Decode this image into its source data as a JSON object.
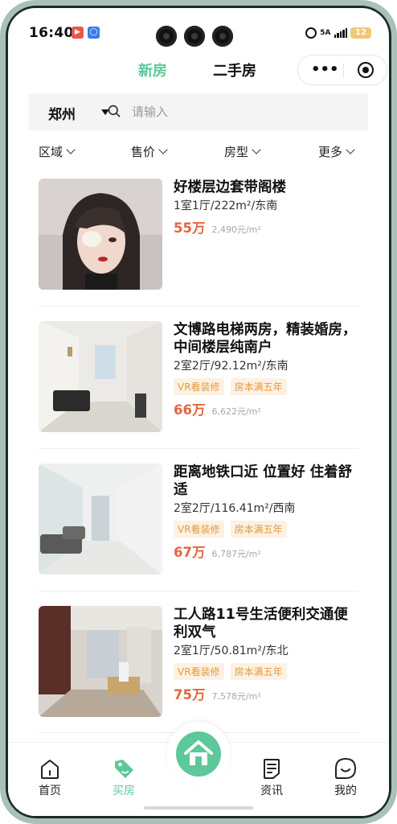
{
  "status_bar": {
    "time": "16:40",
    "network": "5A",
    "battery": "12",
    "accent_battery": "#f0c875"
  },
  "top_nav": {
    "tabs": [
      {
        "label": "新房",
        "active": true
      },
      {
        "label": "二手房",
        "active": false
      }
    ],
    "more_icon": "more-dots-icon",
    "target_icon": "target-icon"
  },
  "search": {
    "city": "郑州",
    "placeholder": "请输入"
  },
  "filters": [
    {
      "label": "区域"
    },
    {
      "label": "售价"
    },
    {
      "label": "房型"
    },
    {
      "label": "更多"
    }
  ],
  "listings": [
    {
      "title": "好楼层边套带阁楼",
      "spec": "1室1厅/222m²/东南",
      "tags": [],
      "price": "55万",
      "unit_price": "2,490元/m²"
    },
    {
      "title": "文博路电梯两房，精装婚房，中间楼层纯南户",
      "spec": "2室2厅/92.12m²/东南",
      "tags": [
        "VR看装修",
        "房本满五年"
      ],
      "price": "66万",
      "unit_price": "6,622元/m²"
    },
    {
      "title": "距离地铁口近 位置好 住着舒适",
      "spec": "2室2厅/116.41m²/西南",
      "tags": [
        "VR看装修",
        "房本满五年"
      ],
      "price": "67万",
      "unit_price": "6,787元/m²"
    },
    {
      "title": "工人路11号生活便利交通便利双气",
      "spec": "2室1厅/50.81m²/东北",
      "tags": [
        "VR看装修",
        "房本满五年"
      ],
      "price": "75万",
      "unit_price": "7,578元/m²"
    }
  ],
  "bottom_nav": {
    "items": [
      {
        "label": "首页",
        "icon": "home-outline-icon"
      },
      {
        "label": "买房",
        "icon": "price-tag-icon",
        "active": true
      },
      {
        "label": "资讯",
        "icon": "news-doc-icon"
      },
      {
        "label": "我的",
        "icon": "smile-face-icon"
      }
    ],
    "center_icon": "house-icon"
  },
  "colors": {
    "brand_green": "#5dc89a",
    "price_red": "#e5643f",
    "tag_orange": "#e39a3c"
  }
}
